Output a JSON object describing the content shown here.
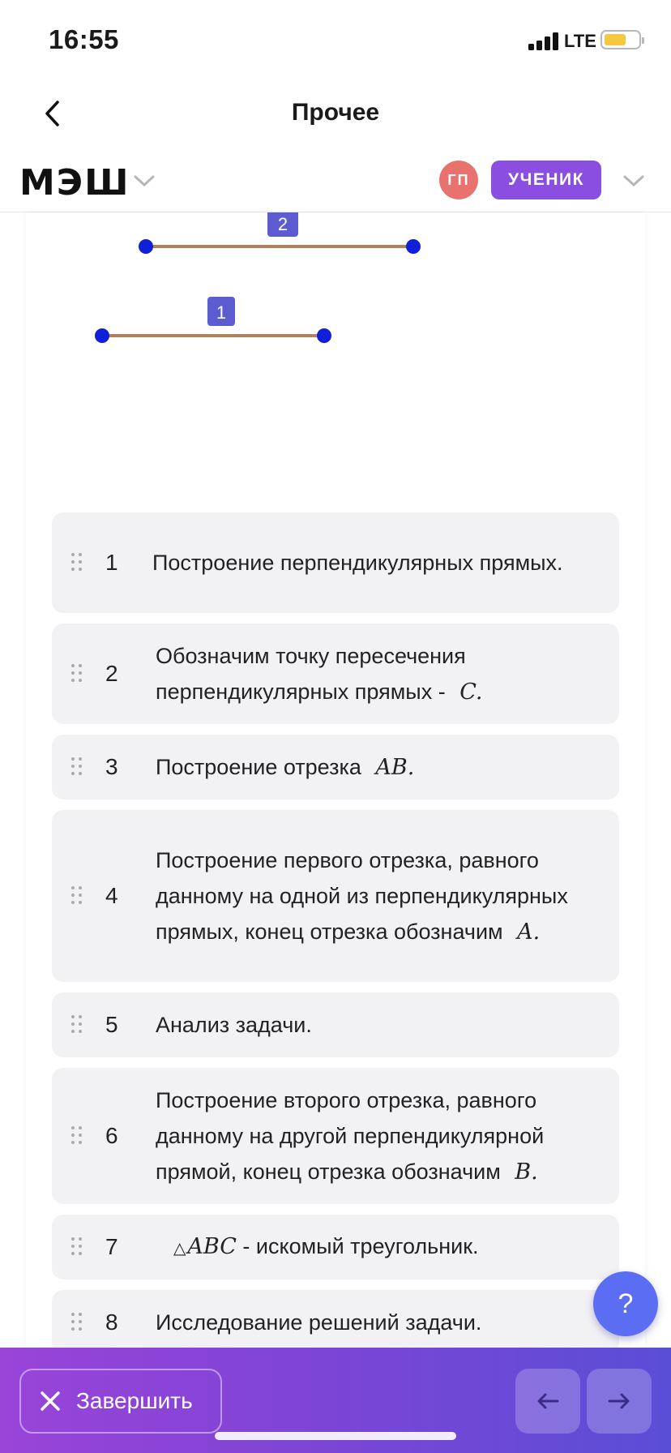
{
  "status_bar": {
    "time": "16:55",
    "network": "LTE"
  },
  "nav": {
    "title": "Прочее"
  },
  "header": {
    "logo": "МЭШ",
    "avatar_initials": "ГП",
    "role_badge": "УЧЕНИК"
  },
  "figure": {
    "segments": [
      {
        "label": "2"
      },
      {
        "label": "1"
      }
    ]
  },
  "steps": [
    {
      "num": "1",
      "text": "Построение перпендикулярных прямых.",
      "math": ""
    },
    {
      "num": "2",
      "text": "Обозначим точку пересечения перпендикулярных прямых - ",
      "math": "C."
    },
    {
      "num": "3",
      "text": "Построение отрезка ",
      "math": "AB."
    },
    {
      "num": "4",
      "text": "Построение первого отрезка, равного данному на одной из перпендикулярных прямых, конец отрезка обозначим ",
      "math": "A."
    },
    {
      "num": "5",
      "text": "Анализ задачи.",
      "math": ""
    },
    {
      "num": "6",
      "text": "Построение второго отрезка, равного данному на другой перпендикулярной прямой, конец отрезка обозначим ",
      "math": "B."
    },
    {
      "num": "7",
      "prefix_math": "ABC",
      "prefix_symbol": "△",
      "text": " - искомый треугольник."
    },
    {
      "num": "8",
      "text": "Исследование решений задачи.",
      "math": ""
    }
  ],
  "help": {
    "label": "?"
  },
  "bottom_bar": {
    "finish_label": "Завершить"
  },
  "colors": {
    "accent_purple": "#8a4fe0",
    "avatar": "#e8726e",
    "help_button": "#5b6df2",
    "segment_line": "#b0825c",
    "segment_point": "#1020d8",
    "segment_label_bg": "#5c5cd0"
  },
  "icons": {
    "back": "chevron-left-icon",
    "dropdown": "chevron-down-icon",
    "drag": "drag-handle-icon",
    "close": "close-icon",
    "prev": "arrow-left-icon",
    "next": "arrow-right-icon"
  }
}
